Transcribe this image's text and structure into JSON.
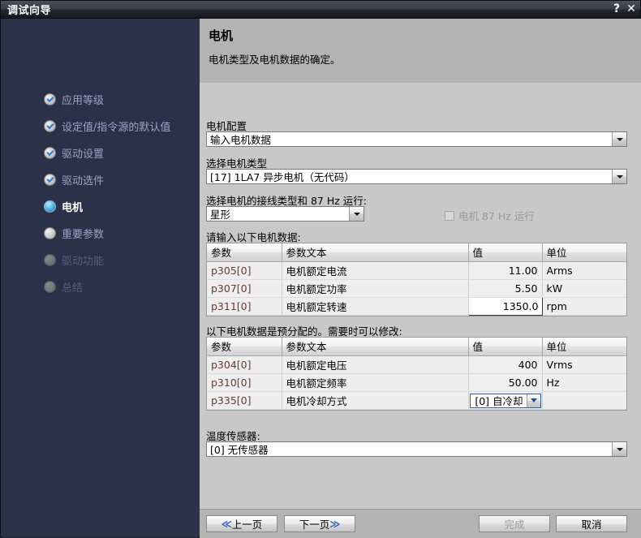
{
  "window": {
    "title": "调试向导",
    "help_button": "?",
    "close_button": "✕"
  },
  "sidebar": {
    "items": [
      {
        "label": "应用等级",
        "state": "done"
      },
      {
        "label": "设定值/指令源的默认值",
        "state": "done"
      },
      {
        "label": "驱动设置",
        "state": "done"
      },
      {
        "label": "驱动选件",
        "state": "done"
      },
      {
        "label": "电机",
        "state": "active"
      },
      {
        "label": "重要参数",
        "state": "pending"
      },
      {
        "label": "驱动功能",
        "state": "disabled"
      },
      {
        "label": "总结",
        "state": "disabled"
      }
    ]
  },
  "pane": {
    "title": "电机",
    "subtitle": "电机类型及电机数据的确定。"
  },
  "form": {
    "motor_config_label": "电机配置",
    "motor_config_value": "输入电机数据",
    "motor_type_label": "选择电机类型",
    "motor_type_value": "[17] 1LA7 异步电机（无代码）",
    "connection_label": "选择电机的接线类型和 87 Hz 运行:",
    "connection_value": "星形",
    "hz87_checkbox_label": "电机 87 Hz 运行",
    "hz87_checked": false,
    "temp_sensor_label": "温度传感器:",
    "temp_sensor_value": "[0] 无传感器"
  },
  "table1": {
    "caption": "请输入以下电机数据:",
    "headers": [
      "参数",
      "参数文本",
      "值",
      "单位"
    ],
    "rows": [
      {
        "param": "p305[0]",
        "text": "电机额定电流",
        "value": "11.00",
        "unit": "Arms",
        "focused": false
      },
      {
        "param": "p307[0]",
        "text": "电机额定功率",
        "value": "5.50",
        "unit": "kW",
        "focused": false
      },
      {
        "param": "p311[0]",
        "text": "电机额定转速",
        "value": "1350.0",
        "unit": "rpm",
        "focused": true
      }
    ]
  },
  "table2": {
    "caption": "以下电机数据是预分配的。需要时可以修改:",
    "headers": [
      "参数",
      "参数文本",
      "值",
      "单位"
    ],
    "rows": [
      {
        "param": "p304[0]",
        "text": "电机额定电压",
        "value": "400",
        "unit": "Vrms",
        "type": "text"
      },
      {
        "param": "p310[0]",
        "text": "电机额定频率",
        "value": "50.00",
        "unit": "Hz",
        "type": "text"
      },
      {
        "param": "p335[0]",
        "text": "电机冷却方式",
        "value": "[0] 自冷却",
        "unit": "",
        "type": "combo"
      }
    ]
  },
  "footer": {
    "prev_label": "上一页",
    "prev_arrow": "≪",
    "next_label": "下一页",
    "next_arrow": "≫",
    "finish_label": "完成",
    "finish_enabled": false,
    "cancel_label": "取消"
  },
  "colors": {
    "title_bar": "#2b3149",
    "sidebar_bg": "#2b3149",
    "pane_bg": "#c8c8c8",
    "header_bg": "#b3b3b3",
    "param_text": "#6a3a2b",
    "accent_blue": "#2b5fb8"
  }
}
